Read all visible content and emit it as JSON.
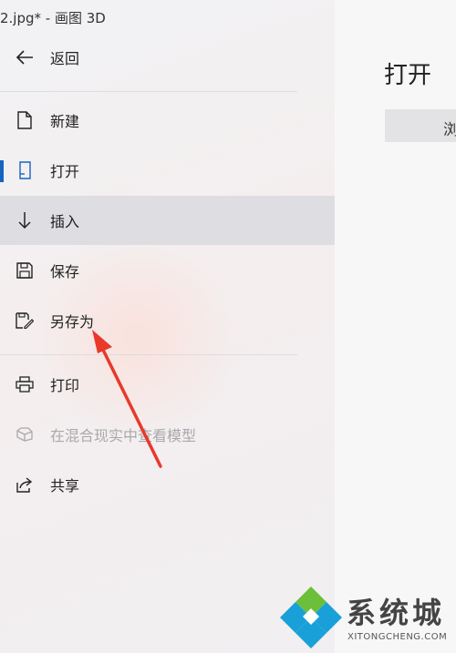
{
  "window": {
    "title": "2.jpg* - 画图 3D"
  },
  "menu": {
    "back": "返回",
    "items": [
      {
        "label": "新建",
        "icon": "new-file-icon"
      },
      {
        "label": "打开",
        "icon": "open-file-icon"
      },
      {
        "label": "插入",
        "icon": "insert-arrow-icon"
      },
      {
        "label": "保存",
        "icon": "save-icon"
      },
      {
        "label": "另存为",
        "icon": "save-as-icon"
      },
      {
        "label": "打印",
        "icon": "print-icon"
      },
      {
        "label": "在混合现实中查看模型",
        "icon": "mixed-reality-icon"
      },
      {
        "label": "共享",
        "icon": "share-icon"
      }
    ]
  },
  "main": {
    "heading": "打开",
    "browse_label": "浏"
  },
  "annotation": {
    "color": "#e8392b"
  },
  "watermark": {
    "text": "系统城",
    "subtext": "XITONGCHENG.COM",
    "colors": [
      "#1aa0d8",
      "#6bbf3a",
      "#1aa0d8",
      "#1aa0d8"
    ]
  }
}
